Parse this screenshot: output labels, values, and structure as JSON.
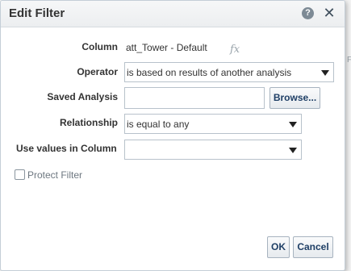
{
  "dialog": {
    "title": "Edit Filter",
    "help_icon_glyph": "?",
    "close_icon_glyph": "✕"
  },
  "form": {
    "column": {
      "label": "Column",
      "value": "att_Tower - Default",
      "formula_glyph": "fx"
    },
    "operator": {
      "label": "Operator",
      "value": "is based on results of another analysis"
    },
    "saved_analysis": {
      "label": "Saved Analysis",
      "value": "",
      "browse_label": "Browse..."
    },
    "relationship": {
      "label": "Relationship",
      "value": "is equal to any"
    },
    "use_values": {
      "label": "Use values in Column",
      "value": ""
    },
    "protect": {
      "label": "Protect Filter",
      "checked": false
    }
  },
  "buttons": {
    "ok": "OK",
    "cancel": "Cancel"
  },
  "background": {
    "glyph": "F"
  }
}
